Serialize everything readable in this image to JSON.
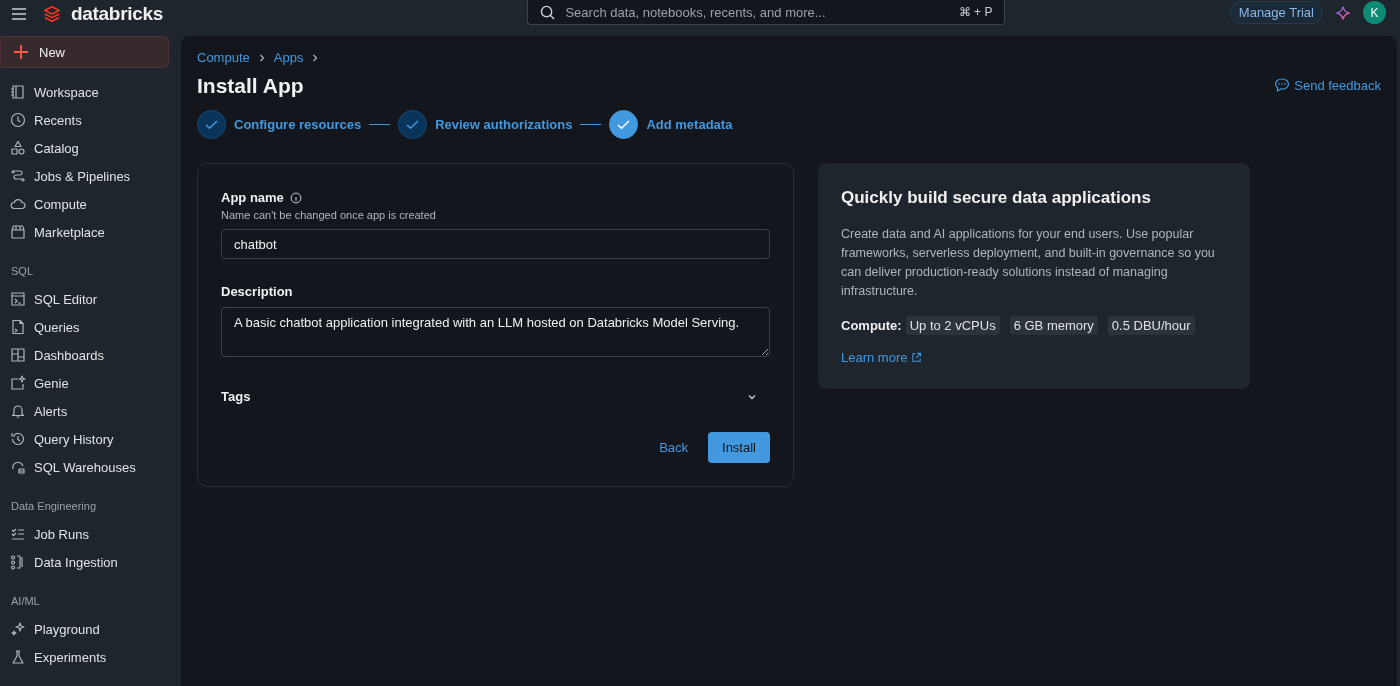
{
  "topbar": {
    "brand": "databricks",
    "search": {
      "placeholder": "Search data, notebooks, recents, and more...",
      "shortcut": "⌘ + P"
    },
    "manage_trial": "Manage Trial",
    "avatar": "K"
  },
  "sidebar": {
    "new_button": "New",
    "sections": [
      {
        "items": [
          {
            "label": "Workspace"
          },
          {
            "label": "Recents"
          },
          {
            "label": "Catalog"
          },
          {
            "label": "Jobs & Pipelines"
          },
          {
            "label": "Compute"
          },
          {
            "label": "Marketplace"
          }
        ]
      },
      {
        "heading": "SQL",
        "items": [
          {
            "label": "SQL Editor"
          },
          {
            "label": "Queries"
          },
          {
            "label": "Dashboards"
          },
          {
            "label": "Genie"
          },
          {
            "label": "Alerts"
          },
          {
            "label": "Query History"
          },
          {
            "label": "SQL Warehouses"
          }
        ]
      },
      {
        "heading": "Data Engineering",
        "items": [
          {
            "label": "Job Runs"
          },
          {
            "label": "Data Ingestion"
          }
        ]
      },
      {
        "heading": "AI/ML",
        "items": [
          {
            "label": "Playground"
          },
          {
            "label": "Experiments"
          }
        ]
      }
    ]
  },
  "breadcrumbs": [
    "Compute",
    "Apps"
  ],
  "title": "Install App",
  "send_feedback": "Send feedback",
  "steps": [
    {
      "label": "Configure resources",
      "selected": false
    },
    {
      "label": "Review authorizations",
      "selected": false
    },
    {
      "label": "Add metadata",
      "selected": true
    }
  ],
  "form": {
    "app_name": {
      "label": "App name",
      "hint": "Name can't be changed once app is created",
      "value": "chatbot"
    },
    "description": {
      "label": "Description",
      "value": "A basic chatbot application integrated with an LLM hosted on Databricks Model Serving."
    },
    "tags": {
      "label": "Tags",
      "expanded": false
    },
    "back": "Back",
    "install": "Install"
  },
  "info": {
    "title": "Quickly build secure data applications",
    "text": "Create data and AI applications for your end users. Use popular frameworks, serverless deployment, and built-in governance so you can deliver production-ready solutions instead of managing infrastructure.",
    "compute_label": "Compute:",
    "chips": [
      "Up to 2 vCPUs",
      "6 GB memory",
      "0.5 DBU/hour"
    ],
    "learn_more": "Learn more"
  }
}
